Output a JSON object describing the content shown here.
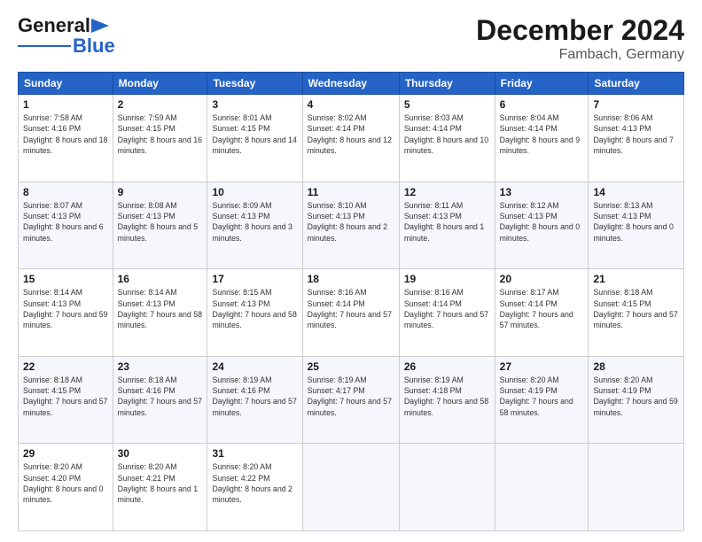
{
  "header": {
    "logo_line1": "General",
    "logo_line2": "Blue",
    "month": "December 2024",
    "location": "Fambach, Germany"
  },
  "weekdays": [
    "Sunday",
    "Monday",
    "Tuesday",
    "Wednesday",
    "Thursday",
    "Friday",
    "Saturday"
  ],
  "weeks": [
    [
      {
        "day": "1",
        "sunrise": "Sunrise: 7:58 AM",
        "sunset": "Sunset: 4:16 PM",
        "daylight": "Daylight: 8 hours and 18 minutes."
      },
      {
        "day": "2",
        "sunrise": "Sunrise: 7:59 AM",
        "sunset": "Sunset: 4:15 PM",
        "daylight": "Daylight: 8 hours and 16 minutes."
      },
      {
        "day": "3",
        "sunrise": "Sunrise: 8:01 AM",
        "sunset": "Sunset: 4:15 PM",
        "daylight": "Daylight: 8 hours and 14 minutes."
      },
      {
        "day": "4",
        "sunrise": "Sunrise: 8:02 AM",
        "sunset": "Sunset: 4:14 PM",
        "daylight": "Daylight: 8 hours and 12 minutes."
      },
      {
        "day": "5",
        "sunrise": "Sunrise: 8:03 AM",
        "sunset": "Sunset: 4:14 PM",
        "daylight": "Daylight: 8 hours and 10 minutes."
      },
      {
        "day": "6",
        "sunrise": "Sunrise: 8:04 AM",
        "sunset": "Sunset: 4:14 PM",
        "daylight": "Daylight: 8 hours and 9 minutes."
      },
      {
        "day": "7",
        "sunrise": "Sunrise: 8:06 AM",
        "sunset": "Sunset: 4:13 PM",
        "daylight": "Daylight: 8 hours and 7 minutes."
      }
    ],
    [
      {
        "day": "8",
        "sunrise": "Sunrise: 8:07 AM",
        "sunset": "Sunset: 4:13 PM",
        "daylight": "Daylight: 8 hours and 6 minutes."
      },
      {
        "day": "9",
        "sunrise": "Sunrise: 8:08 AM",
        "sunset": "Sunset: 4:13 PM",
        "daylight": "Daylight: 8 hours and 5 minutes."
      },
      {
        "day": "10",
        "sunrise": "Sunrise: 8:09 AM",
        "sunset": "Sunset: 4:13 PM",
        "daylight": "Daylight: 8 hours and 3 minutes."
      },
      {
        "day": "11",
        "sunrise": "Sunrise: 8:10 AM",
        "sunset": "Sunset: 4:13 PM",
        "daylight": "Daylight: 8 hours and 2 minutes."
      },
      {
        "day": "12",
        "sunrise": "Sunrise: 8:11 AM",
        "sunset": "Sunset: 4:13 PM",
        "daylight": "Daylight: 8 hours and 1 minute."
      },
      {
        "day": "13",
        "sunrise": "Sunrise: 8:12 AM",
        "sunset": "Sunset: 4:13 PM",
        "daylight": "Daylight: 8 hours and 0 minutes."
      },
      {
        "day": "14",
        "sunrise": "Sunrise: 8:13 AM",
        "sunset": "Sunset: 4:13 PM",
        "daylight": "Daylight: 8 hours and 0 minutes."
      }
    ],
    [
      {
        "day": "15",
        "sunrise": "Sunrise: 8:14 AM",
        "sunset": "Sunset: 4:13 PM",
        "daylight": "Daylight: 7 hours and 59 minutes."
      },
      {
        "day": "16",
        "sunrise": "Sunrise: 8:14 AM",
        "sunset": "Sunset: 4:13 PM",
        "daylight": "Daylight: 7 hours and 58 minutes."
      },
      {
        "day": "17",
        "sunrise": "Sunrise: 8:15 AM",
        "sunset": "Sunset: 4:13 PM",
        "daylight": "Daylight: 7 hours and 58 minutes."
      },
      {
        "day": "18",
        "sunrise": "Sunrise: 8:16 AM",
        "sunset": "Sunset: 4:14 PM",
        "daylight": "Daylight: 7 hours and 57 minutes."
      },
      {
        "day": "19",
        "sunrise": "Sunrise: 8:16 AM",
        "sunset": "Sunset: 4:14 PM",
        "daylight": "Daylight: 7 hours and 57 minutes."
      },
      {
        "day": "20",
        "sunrise": "Sunrise: 8:17 AM",
        "sunset": "Sunset: 4:14 PM",
        "daylight": "Daylight: 7 hours and 57 minutes."
      },
      {
        "day": "21",
        "sunrise": "Sunrise: 8:18 AM",
        "sunset": "Sunset: 4:15 PM",
        "daylight": "Daylight: 7 hours and 57 minutes."
      }
    ],
    [
      {
        "day": "22",
        "sunrise": "Sunrise: 8:18 AM",
        "sunset": "Sunset: 4:15 PM",
        "daylight": "Daylight: 7 hours and 57 minutes."
      },
      {
        "day": "23",
        "sunrise": "Sunrise: 8:18 AM",
        "sunset": "Sunset: 4:16 PM",
        "daylight": "Daylight: 7 hours and 57 minutes."
      },
      {
        "day": "24",
        "sunrise": "Sunrise: 8:19 AM",
        "sunset": "Sunset: 4:16 PM",
        "daylight": "Daylight: 7 hours and 57 minutes."
      },
      {
        "day": "25",
        "sunrise": "Sunrise: 8:19 AM",
        "sunset": "Sunset: 4:17 PM",
        "daylight": "Daylight: 7 hours and 57 minutes."
      },
      {
        "day": "26",
        "sunrise": "Sunrise: 8:19 AM",
        "sunset": "Sunset: 4:18 PM",
        "daylight": "Daylight: 7 hours and 58 minutes."
      },
      {
        "day": "27",
        "sunrise": "Sunrise: 8:20 AM",
        "sunset": "Sunset: 4:19 PM",
        "daylight": "Daylight: 7 hours and 58 minutes."
      },
      {
        "day": "28",
        "sunrise": "Sunrise: 8:20 AM",
        "sunset": "Sunset: 4:19 PM",
        "daylight": "Daylight: 7 hours and 59 minutes."
      }
    ],
    [
      {
        "day": "29",
        "sunrise": "Sunrise: 8:20 AM",
        "sunset": "Sunset: 4:20 PM",
        "daylight": "Daylight: 8 hours and 0 minutes."
      },
      {
        "day": "30",
        "sunrise": "Sunrise: 8:20 AM",
        "sunset": "Sunset: 4:21 PM",
        "daylight": "Daylight: 8 hours and 1 minute."
      },
      {
        "day": "31",
        "sunrise": "Sunrise: 8:20 AM",
        "sunset": "Sunset: 4:22 PM",
        "daylight": "Daylight: 8 hours and 2 minutes."
      },
      null,
      null,
      null,
      null
    ]
  ]
}
